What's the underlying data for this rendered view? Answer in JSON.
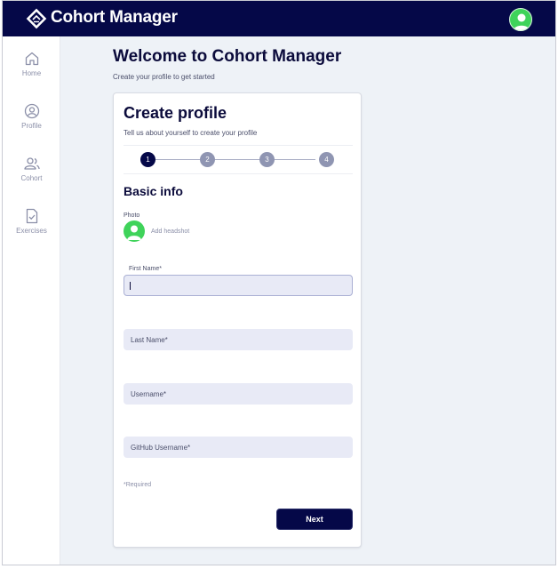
{
  "header": {
    "app_title": "Cohort Manager",
    "logo_icon": "diamond-logo-icon",
    "avatar_color": "#3fd35a",
    "background": "#050848"
  },
  "sidebar": {
    "items": [
      {
        "label": "Home",
        "icon": "home-icon"
      },
      {
        "label": "Profile",
        "icon": "profile-icon"
      },
      {
        "label": "Cohort",
        "icon": "cohort-icon"
      },
      {
        "label": "Exercises",
        "icon": "exercises-icon"
      }
    ]
  },
  "main": {
    "title": "Welcome to Cohort Manager",
    "subtitle": "Create your profile to get started"
  },
  "card": {
    "title": "Create profile",
    "subtitle": "Tell us about yourself to create your profile",
    "steps": [
      "1",
      "2",
      "3",
      "4"
    ],
    "active_step": 1,
    "section_title": "Basic info",
    "photo_label": "Photo",
    "add_headshot": "Add headshot",
    "fields": {
      "first_name": {
        "label": "First Name*",
        "value": ""
      },
      "last_name": {
        "placeholder": "Last Name*"
      },
      "username": {
        "placeholder": "Username*"
      },
      "github_username": {
        "placeholder": "GitHub Username*"
      }
    },
    "required_note": "*Required",
    "next_label": "Next"
  },
  "colors": {
    "primary": "#050848",
    "step_inactive": "#8f95b2",
    "input_bg": "#e8eaf6",
    "avatar": "#3fd35a"
  }
}
